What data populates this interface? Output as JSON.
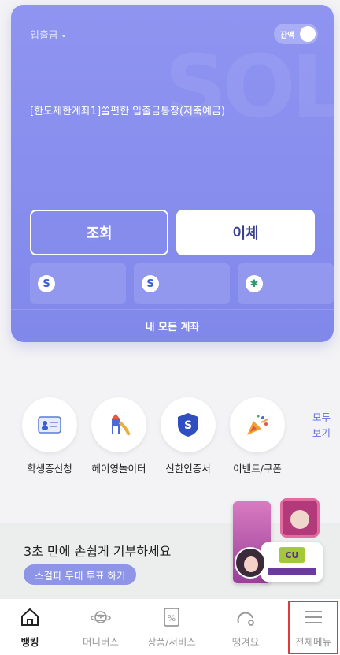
{
  "account_card": {
    "account_type": "입출금",
    "type_dot": "•",
    "balance_toggle_label": "잔액",
    "account_name": "[한도제한계좌1]쏠편한 입출금통장(저축예금)",
    "watermark": "SOL",
    "inquiry_button": "조회",
    "transfer_button": "이체",
    "all_accounts": "내 모든 계좌",
    "mini_cards": [
      {
        "icon": "S",
        "color": "#3a5fd0"
      },
      {
        "icon": "S",
        "color": "#3a5fd0"
      },
      {
        "icon": "✱",
        "color": "#2a9a70"
      }
    ]
  },
  "quick_menu": {
    "items": [
      {
        "label": "학생증신청",
        "icon": "id-card-icon"
      },
      {
        "label": "헤이영놀이터",
        "icon": "playground-icon"
      },
      {
        "label": "신한인증서",
        "icon": "shield-icon"
      },
      {
        "label": "이벤트/쿠폰",
        "icon": "party-popper-icon"
      }
    ],
    "see_all_line1": "모두",
    "see_all_line2": "보기"
  },
  "banner": {
    "title": "3초 만에 손쉽게 기부하세요",
    "button": "스걸파 무대 투표 하기",
    "cu_logo": "CU"
  },
  "bottom_nav": {
    "items": [
      {
        "label": "뱅킹",
        "icon": "home-icon",
        "active": true
      },
      {
        "label": "머니버스",
        "icon": "planet-icon",
        "active": false
      },
      {
        "label": "상품/서비스",
        "icon": "percent-doc-icon",
        "active": false
      },
      {
        "label": "땡겨요",
        "icon": "delivery-icon",
        "active": false
      },
      {
        "label": "전체메뉴",
        "icon": "hamburger-menu-icon",
        "active": false
      }
    ]
  },
  "colors": {
    "card_bg": "#8b90ee",
    "accent": "#6470e0",
    "highlight": "#e03b3b"
  }
}
